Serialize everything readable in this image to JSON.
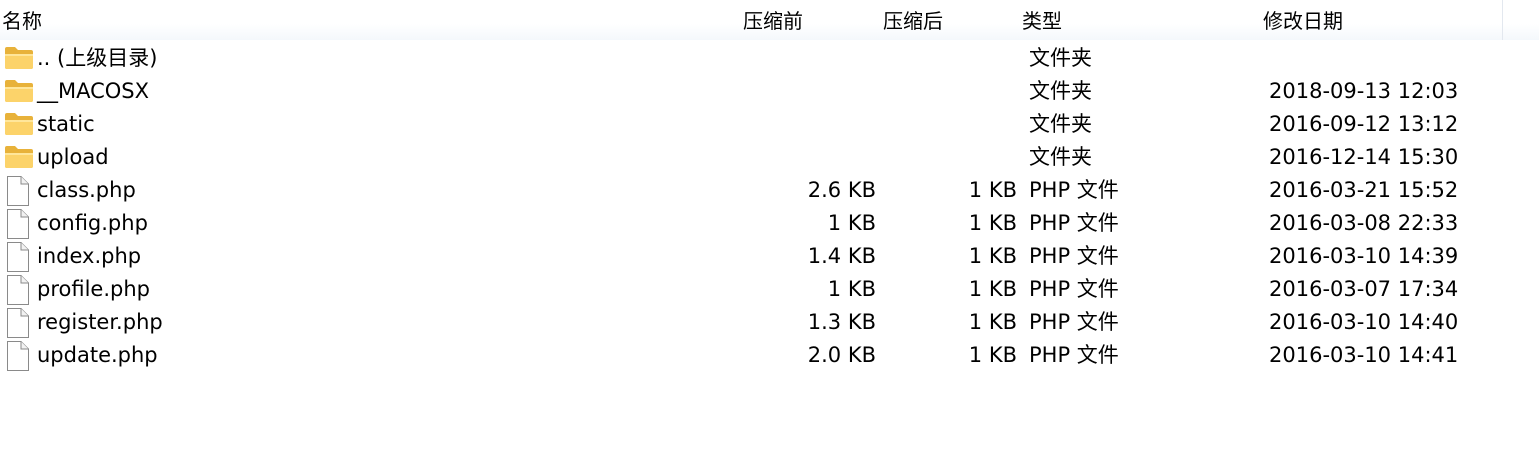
{
  "columns": {
    "name": "名称",
    "compressed": "压缩前",
    "uncompressed": "压缩后",
    "type": "类型",
    "modified": "修改日期"
  },
  "rows": [
    {
      "icon": "folder-icon",
      "name": ".. (上级目录)",
      "compressed": "",
      "uncompressed": "",
      "type": "文件夹",
      "modified": ""
    },
    {
      "icon": "folder-icon",
      "name": "__MACOSX",
      "compressed": "",
      "uncompressed": "",
      "type": "文件夹",
      "modified": "2018-09-13 12:03"
    },
    {
      "icon": "folder-icon",
      "name": "static",
      "compressed": "",
      "uncompressed": "",
      "type": "文件夹",
      "modified": "2016-09-12 13:12"
    },
    {
      "icon": "folder-icon",
      "name": "upload",
      "compressed": "",
      "uncompressed": "",
      "type": "文件夹",
      "modified": "2016-12-14 15:30"
    },
    {
      "icon": "file-icon",
      "name": "class.php",
      "compressed": "2.6 KB",
      "uncompressed": "1 KB",
      "type": "PHP 文件",
      "modified": "2016-03-21 15:52"
    },
    {
      "icon": "file-icon",
      "name": "config.php",
      "compressed": "1 KB",
      "uncompressed": "1 KB",
      "type": "PHP 文件",
      "modified": "2016-03-08 22:33"
    },
    {
      "icon": "file-icon",
      "name": "index.php",
      "compressed": "1.4 KB",
      "uncompressed": "1 KB",
      "type": "PHP 文件",
      "modified": "2016-03-10 14:39"
    },
    {
      "icon": "file-icon",
      "name": "profile.php",
      "compressed": "1 KB",
      "uncompressed": "1 KB",
      "type": "PHP 文件",
      "modified": "2016-03-07 17:34"
    },
    {
      "icon": "file-icon",
      "name": "register.php",
      "compressed": "1.3 KB",
      "uncompressed": "1 KB",
      "type": "PHP 文件",
      "modified": "2016-03-10 14:40"
    },
    {
      "icon": "file-icon",
      "name": "update.php",
      "compressed": "2.0 KB",
      "uncompressed": "1 KB",
      "type": "PHP 文件",
      "modified": "2016-03-10 14:41"
    }
  ]
}
